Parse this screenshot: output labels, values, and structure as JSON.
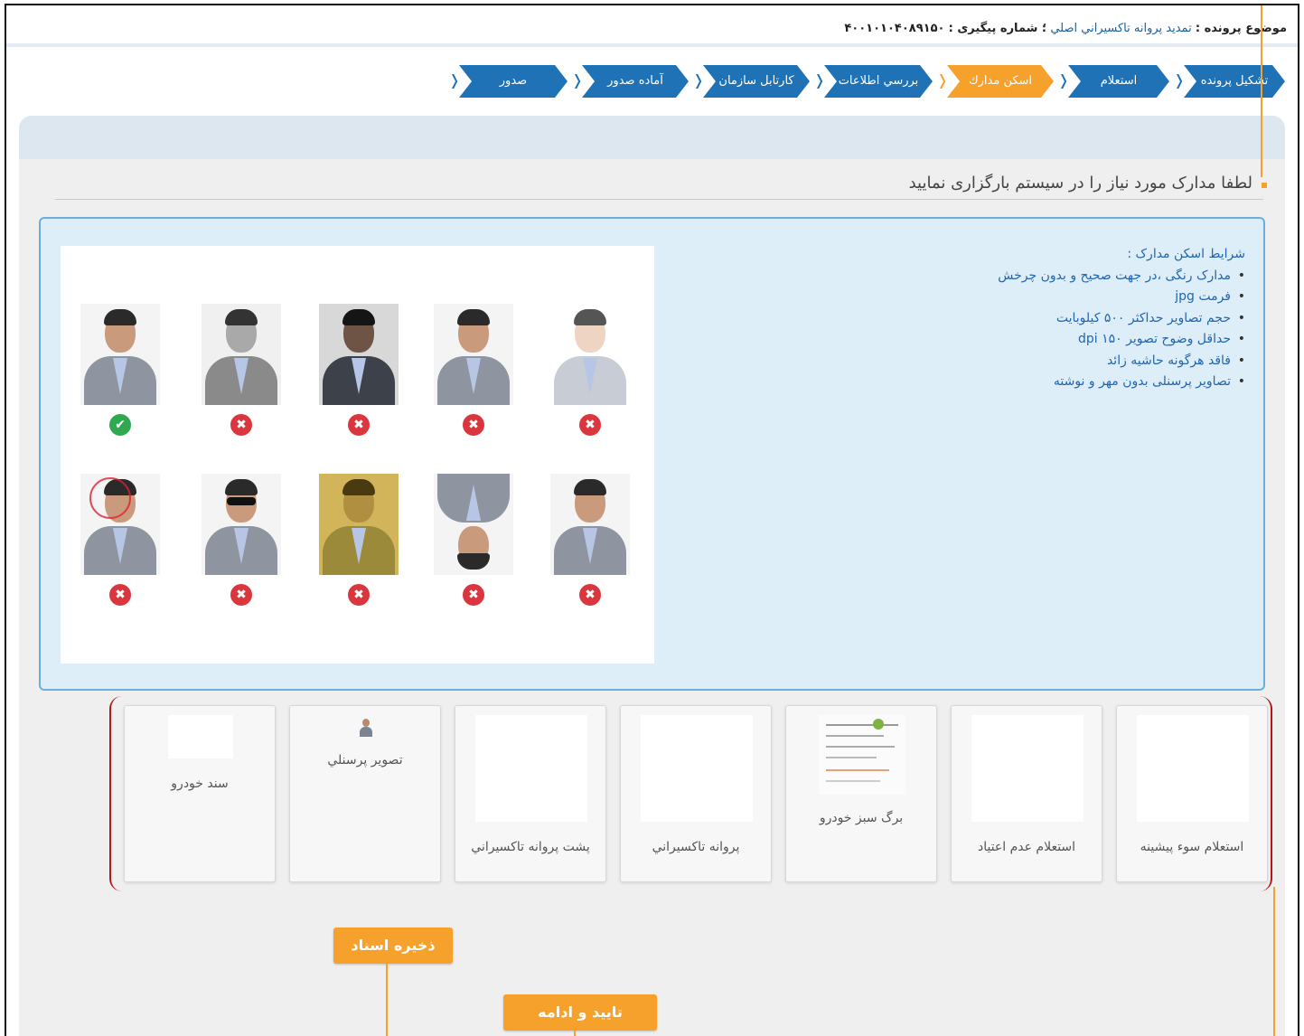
{
  "header": {
    "subject_label": "موضوع پرونده :",
    "subject_value": "تمديد پروانه تاكسيراني اصلي",
    "tracking_label": "؛ شماره پیگیری :",
    "tracking_value": "۴۰۰۱۰۱۰۴۰۸۹۱۵۰"
  },
  "steps": [
    {
      "label": "تشكيل پرونده",
      "active": false
    },
    {
      "label": "استعلام",
      "active": false
    },
    {
      "label": "اسكن مدارك",
      "active": true
    },
    {
      "label": "بررسي اطلاعات",
      "active": false
    },
    {
      "label": "كارتابل سازمان",
      "active": false
    },
    {
      "label": "آماده صدور",
      "active": false
    },
    {
      "label": "صدور",
      "active": false
    }
  ],
  "instruction": "لطفا مدارک مورد نیاز را در سیستم بارگزاری نمایید",
  "conditions": {
    "title": "شرایط اسکن مدارک :",
    "items": [
      "مدارک رنگی ،در جهت صحیح و بدون چرخش",
      "فرمت jpg",
      "حجم تصاویر حداکثر ۵۰۰ کیلوبایت",
      "حداقل وضوح تصویر ۱۵۰ dpi",
      "فاقد هرگونه حاشیه زائد",
      "تصاویر پرسنلی بدون مهر و نوشته"
    ]
  },
  "sample_photos": [
    {
      "status": "valid",
      "variant": "correct"
    },
    {
      "status": "invalid",
      "variant": "grayscale"
    },
    {
      "status": "invalid",
      "variant": "dark"
    },
    {
      "status": "invalid",
      "variant": "normal"
    },
    {
      "status": "invalid",
      "variant": "overexposed"
    },
    {
      "status": "invalid",
      "variant": "stamped"
    },
    {
      "status": "invalid",
      "variant": "sunglasses"
    },
    {
      "status": "invalid",
      "variant": "yellow-tint"
    },
    {
      "status": "invalid",
      "variant": "upside-down"
    },
    {
      "status": "invalid",
      "variant": "normal"
    }
  ],
  "status_icons": {
    "valid": "check-circle-icon",
    "invalid": "x-circle-icon"
  },
  "documents": [
    {
      "label": "سند خودرو",
      "thumb": "empty"
    },
    {
      "label": "تصوير پرسنلي",
      "thumb": "person"
    },
    {
      "label": "پشت پروانه تاكسيراني",
      "thumb": "empty"
    },
    {
      "label": "پروانه تاكسيراني",
      "thumb": "empty"
    },
    {
      "label": "برگ سبز خودرو",
      "thumb": "document"
    },
    {
      "label": "استعلام عدم اعتياد",
      "thumb": "empty"
    },
    {
      "label": "استعلام سوء پيشينه",
      "thumb": "empty"
    }
  ],
  "buttons": {
    "save": "ذخیره اسناد",
    "confirm": "تایید و ادامه"
  },
  "colors": {
    "primary": "#1f72b5",
    "accent": "#f6a12b",
    "info_bg": "#ddeef8",
    "bracket": "#b01818"
  }
}
